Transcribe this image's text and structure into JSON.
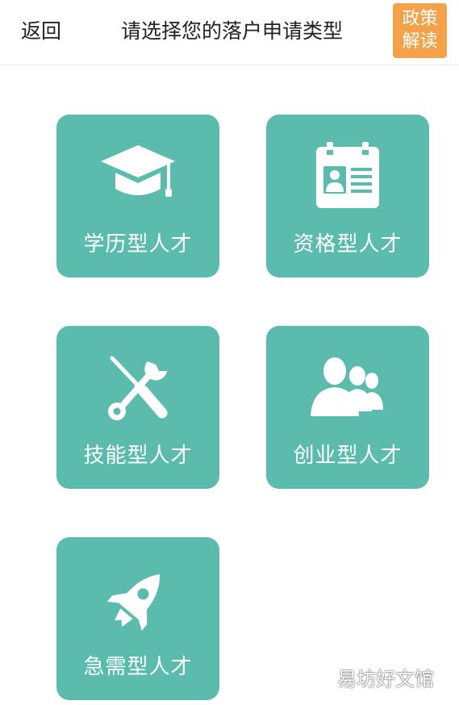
{
  "colors": {
    "card_bg": "#5bbcae",
    "policy_button_bg": "#f4a24a",
    "text_dark": "#222222"
  },
  "header": {
    "back_label": "返回",
    "title": "请选择您的落户申请类型",
    "policy_button": {
      "line1": "政策",
      "line2": "解读"
    }
  },
  "cards": [
    {
      "label": "学历型人才",
      "icon": "graduation-cap-icon"
    },
    {
      "label": "资格型人才",
      "icon": "id-badge-icon"
    },
    {
      "label": "技能型人才",
      "icon": "wrench-screwdriver-icon"
    },
    {
      "label": "创业型人才",
      "icon": "people-group-icon"
    },
    {
      "label": "急需型人才",
      "icon": "rocket-icon"
    }
  ],
  "watermark": "易坊好文馆"
}
